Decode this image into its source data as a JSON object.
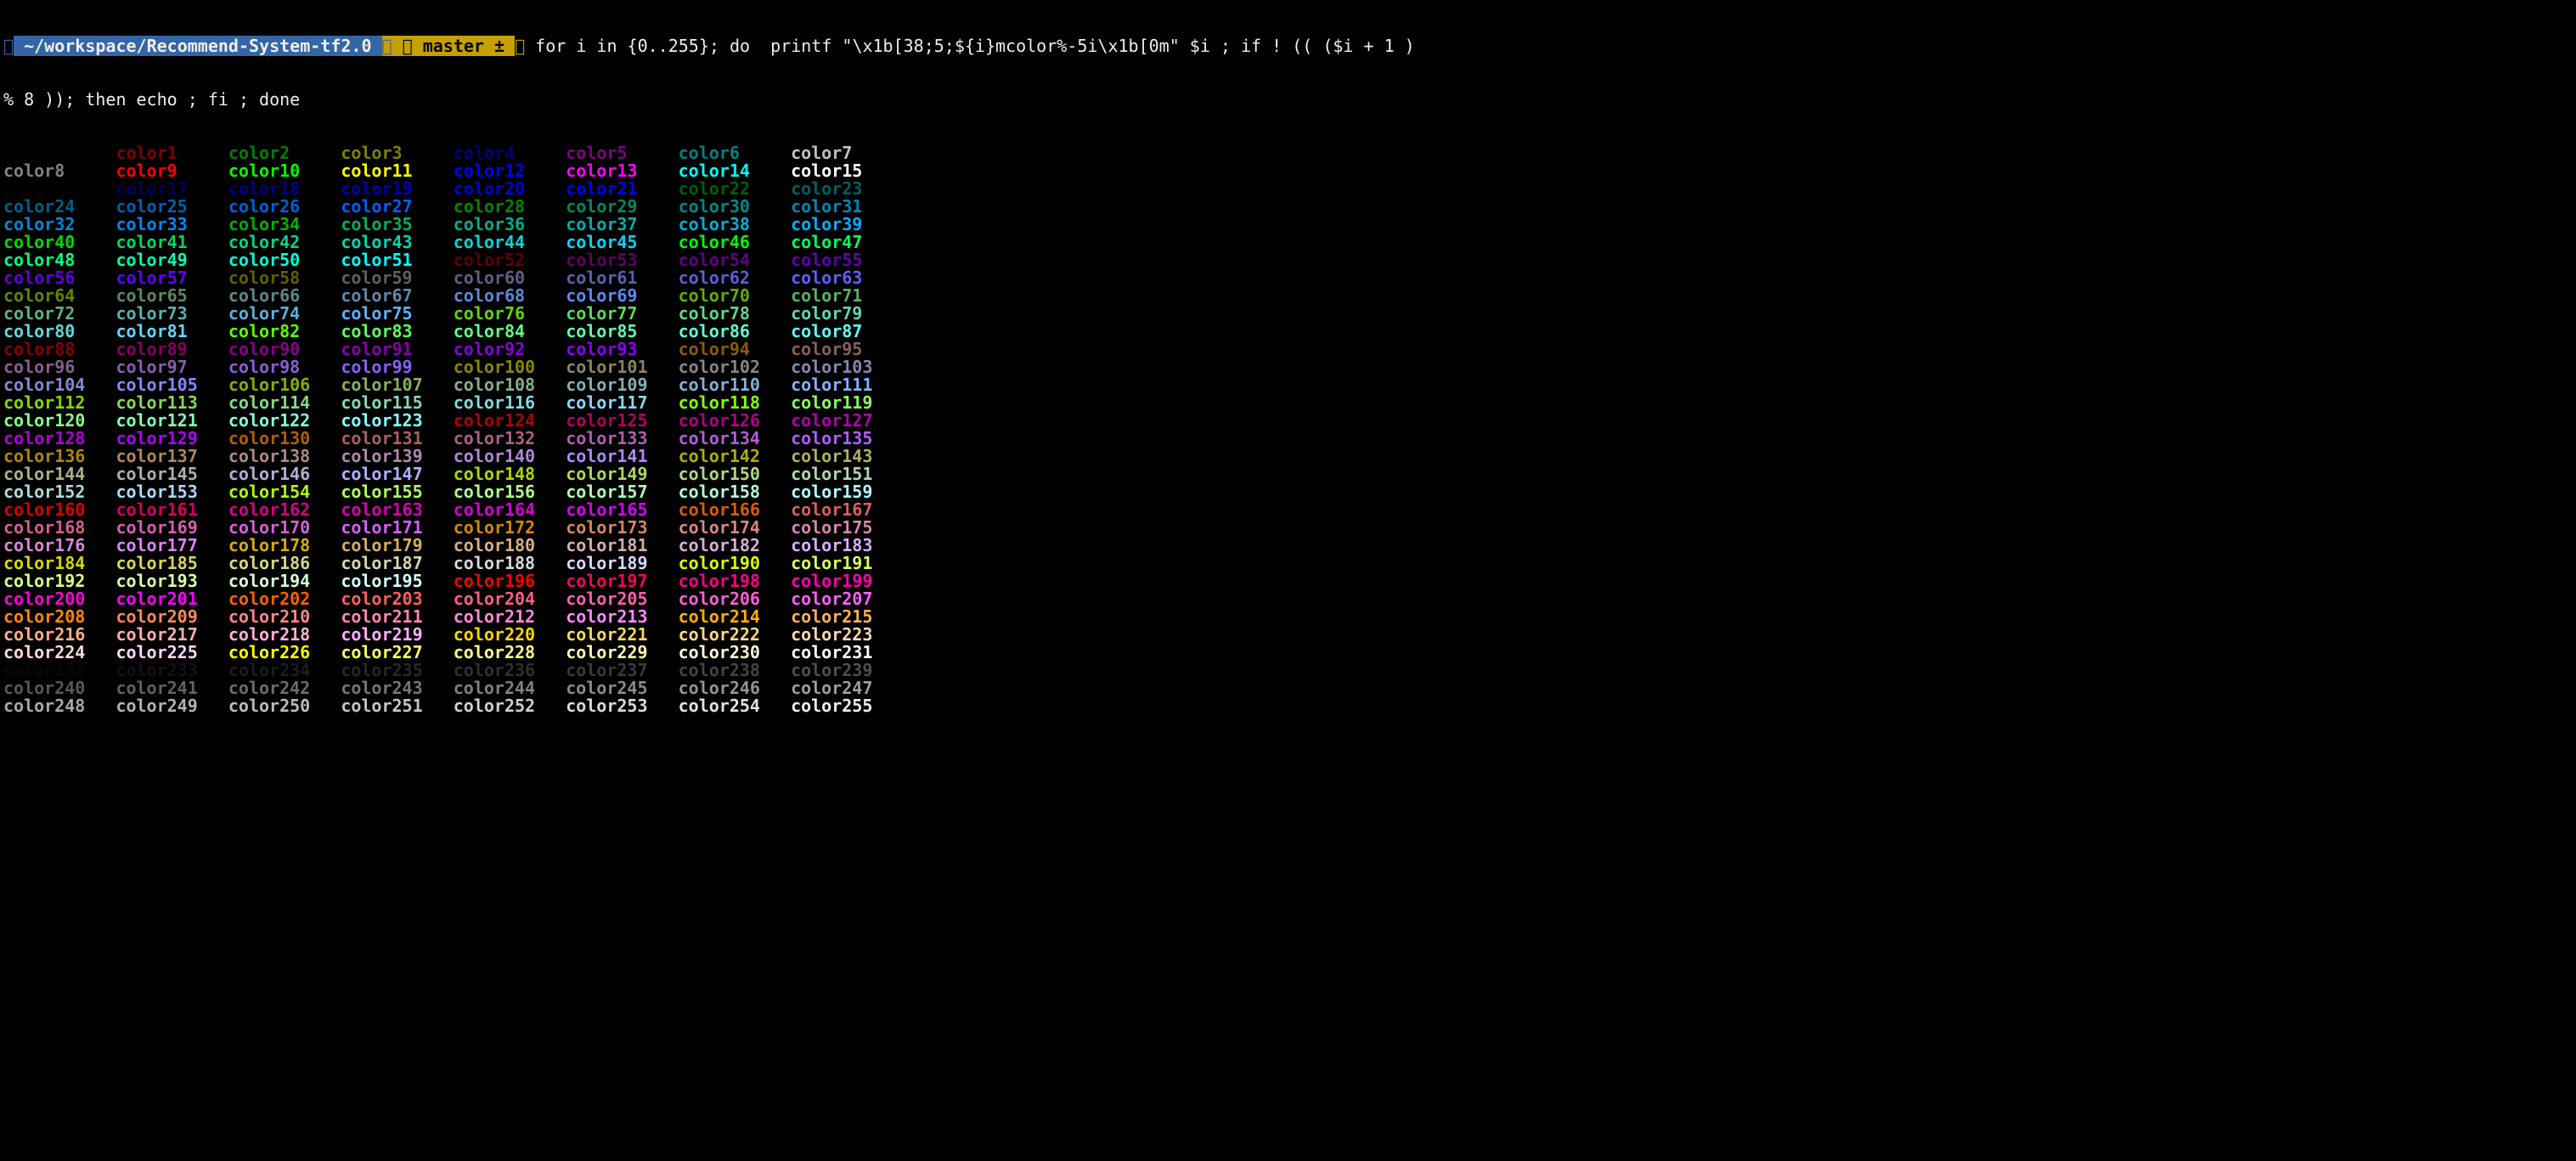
{
  "prompt": {
    "path": " ~/workspace/Recommend-System-tf2.0 ",
    "git": " ⎇ master ± ",
    "command_line1": " for i in {0..255}; do  printf \"\\x1b[38;5;${i}mcolor%-5i\\x1b[0m\" $i ; if ! (( ($i + 1 )",
    "command_line2": "% 8 )); then echo ; fi ; done"
  },
  "label_prefix": "color",
  "count": 256,
  "columns": 8,
  "xterm256": [
    "#000000",
    "#800000",
    "#008000",
    "#808000",
    "#000080",
    "#800080",
    "#008080",
    "#c0c0c0",
    "#808080",
    "#ff0000",
    "#00ff00",
    "#ffff00",
    "#0000ff",
    "#ff00ff",
    "#00ffff",
    "#ffffff",
    "#000000",
    "#00005f",
    "#000087",
    "#0000af",
    "#0000d7",
    "#0000ff",
    "#005f00",
    "#005f5f",
    "#005f87",
    "#005faf",
    "#005fd7",
    "#005fff",
    "#008700",
    "#00875f",
    "#008787",
    "#0087af",
    "#0087d7",
    "#0087ff",
    "#00af00",
    "#00af5f",
    "#00af87",
    "#00afaf",
    "#00afd7",
    "#00afff",
    "#00d700",
    "#00d75f",
    "#00d787",
    "#00d7af",
    "#00d7d7",
    "#00d7ff",
    "#00ff00",
    "#00ff5f",
    "#00ff87",
    "#00ffaf",
    "#00ffd7",
    "#00ffff",
    "#5f0000",
    "#5f005f",
    "#5f0087",
    "#5f00af",
    "#5f00d7",
    "#5f00ff",
    "#5f5f00",
    "#5f5f5f",
    "#5f5f87",
    "#5f5faf",
    "#5f5fd7",
    "#5f5fff",
    "#5f8700",
    "#5f875f",
    "#5f8787",
    "#5f87af",
    "#5f87d7",
    "#5f87ff",
    "#5faf00",
    "#5faf5f",
    "#5faf87",
    "#5fafaf",
    "#5fafd7",
    "#5fafff",
    "#5fd700",
    "#5fd75f",
    "#5fd787",
    "#5fd7af",
    "#5fd7d7",
    "#5fd7ff",
    "#5fff00",
    "#5fff5f",
    "#5fff87",
    "#5fffaf",
    "#5fffd7",
    "#5fffff",
    "#870000",
    "#87005f",
    "#870087",
    "#8700af",
    "#8700d7",
    "#8700ff",
    "#875f00",
    "#875f5f",
    "#875f87",
    "#875faf",
    "#875fd7",
    "#875fff",
    "#878700",
    "#87875f",
    "#878787",
    "#8787af",
    "#8787d7",
    "#8787ff",
    "#87af00",
    "#87af5f",
    "#87af87",
    "#87afaf",
    "#87afd7",
    "#87afff",
    "#87d700",
    "#87d75f",
    "#87d787",
    "#87d7af",
    "#87d7d7",
    "#87d7ff",
    "#87ff00",
    "#87ff5f",
    "#87ff87",
    "#87ffaf",
    "#87ffd7",
    "#87ffff",
    "#af0000",
    "#af005f",
    "#af0087",
    "#af00af",
    "#af00d7",
    "#af00ff",
    "#af5f00",
    "#af5f5f",
    "#af5f87",
    "#af5faf",
    "#af5fd7",
    "#af5fff",
    "#af8700",
    "#af875f",
    "#af8787",
    "#af87af",
    "#af87d7",
    "#af87ff",
    "#afaf00",
    "#afaf5f",
    "#afaf87",
    "#afafaf",
    "#afafd7",
    "#afafff",
    "#afd700",
    "#afd75f",
    "#afd787",
    "#afd7af",
    "#afd7d7",
    "#afd7ff",
    "#afff00",
    "#afff5f",
    "#afff87",
    "#afffaf",
    "#afffd7",
    "#afffff",
    "#d70000",
    "#d7005f",
    "#d70087",
    "#d700af",
    "#d700d7",
    "#d700ff",
    "#d75f00",
    "#d75f5f",
    "#d75f87",
    "#d75faf",
    "#d75fd7",
    "#d75fff",
    "#d78700",
    "#d7875f",
    "#d78787",
    "#d787af",
    "#d787d7",
    "#d787ff",
    "#d7af00",
    "#d7af5f",
    "#d7af87",
    "#d7afaf",
    "#d7afd7",
    "#d7afff",
    "#d7d700",
    "#d7d75f",
    "#d7d787",
    "#d7d7af",
    "#d7d7d7",
    "#d7d7ff",
    "#d7ff00",
    "#d7ff5f",
    "#d7ff87",
    "#d7ffaf",
    "#d7ffd7",
    "#d7ffff",
    "#ff0000",
    "#ff005f",
    "#ff0087",
    "#ff00af",
    "#ff00d7",
    "#ff00ff",
    "#ff5f00",
    "#ff5f5f",
    "#ff5f87",
    "#ff5faf",
    "#ff5fd7",
    "#ff5fff",
    "#ff8700",
    "#ff875f",
    "#ff8787",
    "#ff87af",
    "#ff87d7",
    "#ff87ff",
    "#ffaf00",
    "#ffaf5f",
    "#ffaf87",
    "#ffafaf",
    "#ffafd7",
    "#ffafff",
    "#ffd700",
    "#ffd75f",
    "#ffd787",
    "#ffd7af",
    "#ffd7d7",
    "#ffd7ff",
    "#ffff00",
    "#ffff5f",
    "#ffff87",
    "#ffffaf",
    "#ffffd7",
    "#ffffff",
    "#080808",
    "#121212",
    "#1c1c1c",
    "#262626",
    "#303030",
    "#3a3a3a",
    "#444444",
    "#4e4e4e",
    "#585858",
    "#626262",
    "#6c6c6c",
    "#767676",
    "#808080",
    "#8a8a8a",
    "#949494",
    "#9e9e9e",
    "#a8a8a8",
    "#b2b2b2",
    "#bcbcbc",
    "#c6c6c6",
    "#d0d0d0",
    "#dadada",
    "#e4e4e4",
    "#eeeeee"
  ]
}
